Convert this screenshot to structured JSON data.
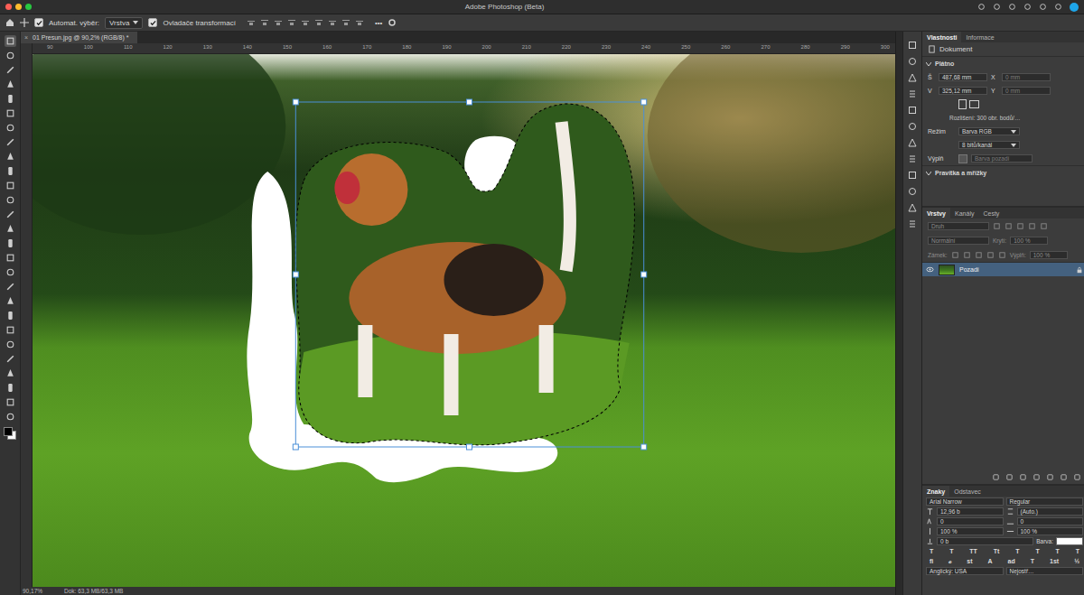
{
  "window": {
    "title": "Adobe Photoshop (Beta)"
  },
  "options_bar": {
    "auto_select_label": "Automat. výběr:",
    "auto_select_checked": true,
    "target": "Vrstva",
    "transform_label": "Ovladače transformací",
    "transform_checked": true,
    "more": "•••"
  },
  "document_tab": {
    "title": "01 Presun.jpg @ 90,2% (RGB/8) *",
    "close": "×"
  },
  "ruler": {
    "top": [
      "90",
      "100",
      "110",
      "120",
      "130",
      "140",
      "150",
      "160",
      "170",
      "180",
      "190",
      "200",
      "210",
      "220",
      "230",
      "240",
      "250",
      "260",
      "270",
      "280",
      "290",
      "300"
    ]
  },
  "status_bar": {
    "zoom": "90,17%",
    "doc": "Dok: 63,3 MB/63,3 MB"
  },
  "properties": {
    "tabs": [
      {
        "label": "Vlastnosti",
        "selected": true
      },
      {
        "label": "Informace",
        "selected": false
      }
    ],
    "type": "Dokument",
    "canvas_section": "Plátno",
    "size_rows": [
      {
        "label": "Š",
        "value": "487,68 mm",
        "axis": "X",
        "axis_value": "0 mm",
        "axis_disabled": true
      },
      {
        "label": "V",
        "value": "325,12 mm",
        "axis": "Y",
        "axis_value": "0 mm",
        "axis_disabled": true
      }
    ],
    "resolution": "Rozlišení: 300 obr. bodů/…",
    "mode_label": "Režim",
    "mode": "Barva RGB",
    "depth": "8 bitů/kanál",
    "fill_label": "Výplň",
    "fill": "Barva pozadí",
    "fill_disabled": true,
    "rulers_section": "Pravítka a mřížky"
  },
  "layers": {
    "tabs": [
      {
        "label": "Vrstvy",
        "selected": true
      },
      {
        "label": "Kanály",
        "selected": false
      },
      {
        "label": "Cesty",
        "selected": false
      }
    ],
    "filter": "Druh",
    "blend": "Normální",
    "opacity_label": "Krytí:",
    "opacity": "100 %",
    "lock_label": "Zámek:",
    "fill_label": "Výplň:",
    "fill": "100 %",
    "items": [
      {
        "name": "Pozadí",
        "visible": true,
        "selected": true,
        "locked": true
      }
    ]
  },
  "character": {
    "tabs": [
      {
        "label": "Znaky",
        "selected": true
      },
      {
        "label": "Odstavec",
        "selected": false
      }
    ],
    "font": "Arial Narrow",
    "style": "Regular",
    "size": "12,96 b",
    "leading": "(Auto.)",
    "kerning": "0",
    "tracking": "0",
    "vscale": "100 %",
    "hscale": "100 %",
    "baseline": "0 b",
    "color_label": "Barva:",
    "color": "#ffffff",
    "style_buttons": [
      "T",
      "T",
      "TT",
      "Tt",
      "T",
      "T",
      "T",
      "T"
    ],
    "ot_buttons": [
      "fi",
      "ℴ",
      "st",
      "A",
      "ad",
      "T",
      "1st",
      "½"
    ],
    "language": "Anglický: USA",
    "antialias": "Nejostř…"
  }
}
